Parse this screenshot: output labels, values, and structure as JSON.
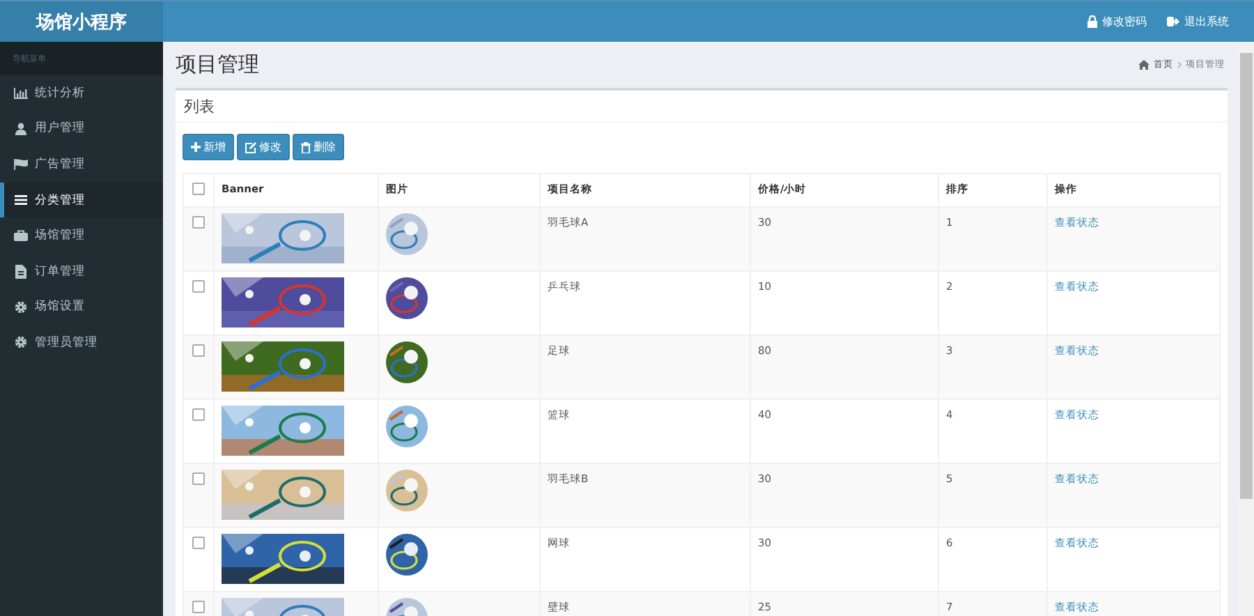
{
  "brand": "场馆小程序",
  "header_links": [
    {
      "kind": "lock",
      "label": "修改密码"
    },
    {
      "kind": "logout",
      "label": "退出系统"
    }
  ],
  "sidebar": {
    "heading": "导航菜单",
    "items": [
      {
        "kind": "chart",
        "label": "统计分析",
        "selected": false
      },
      {
        "kind": "user",
        "label": "用户管理",
        "selected": false
      },
      {
        "kind": "flag",
        "label": "广告管理",
        "selected": false
      },
      {
        "kind": "list",
        "label": "分类管理",
        "selected": true
      },
      {
        "kind": "case",
        "label": "场馆管理",
        "selected": false
      },
      {
        "kind": "file",
        "label": "订单管理",
        "selected": false
      },
      {
        "kind": "gear",
        "label": "场馆设置",
        "selected": false
      },
      {
        "kind": "gear",
        "label": "管理员管理",
        "selected": false
      }
    ]
  },
  "page_title": "项目管理",
  "breadcrumb": [
    "首页",
    "项目管理"
  ],
  "box_title": "列表",
  "buttons": [
    {
      "kind": "plus",
      "label": "新增"
    },
    {
      "kind": "edit",
      "label": "修改"
    },
    {
      "kind": "trash",
      "label": "删除"
    }
  ],
  "table": {
    "header_checked": false,
    "columns": [
      "Banner",
      "图片",
      "项目名称",
      "价格/小时",
      "排序",
      "操作"
    ],
    "rows": [
      {
        "checked": false,
        "name": "羽毛球A",
        "price": "30",
        "order": "1",
        "action": "查看状态"
      },
      {
        "checked": false,
        "name": "乒乓球",
        "price": "10",
        "order": "2",
        "action": "查看状态"
      },
      {
        "checked": false,
        "name": "足球",
        "price": "80",
        "order": "3",
        "action": "查看状态"
      },
      {
        "checked": false,
        "name": "篮球",
        "price": "40",
        "order": "4",
        "action": "查看状态"
      },
      {
        "checked": false,
        "name": "羽毛球B",
        "price": "30",
        "order": "5",
        "action": "查看状态"
      },
      {
        "checked": false,
        "name": "网球",
        "price": "30",
        "order": "6",
        "action": "查看状态"
      },
      {
        "checked": false,
        "name": "壁球",
        "price": "25",
        "order": "7",
        "action": "查看状态"
      }
    ]
  }
}
